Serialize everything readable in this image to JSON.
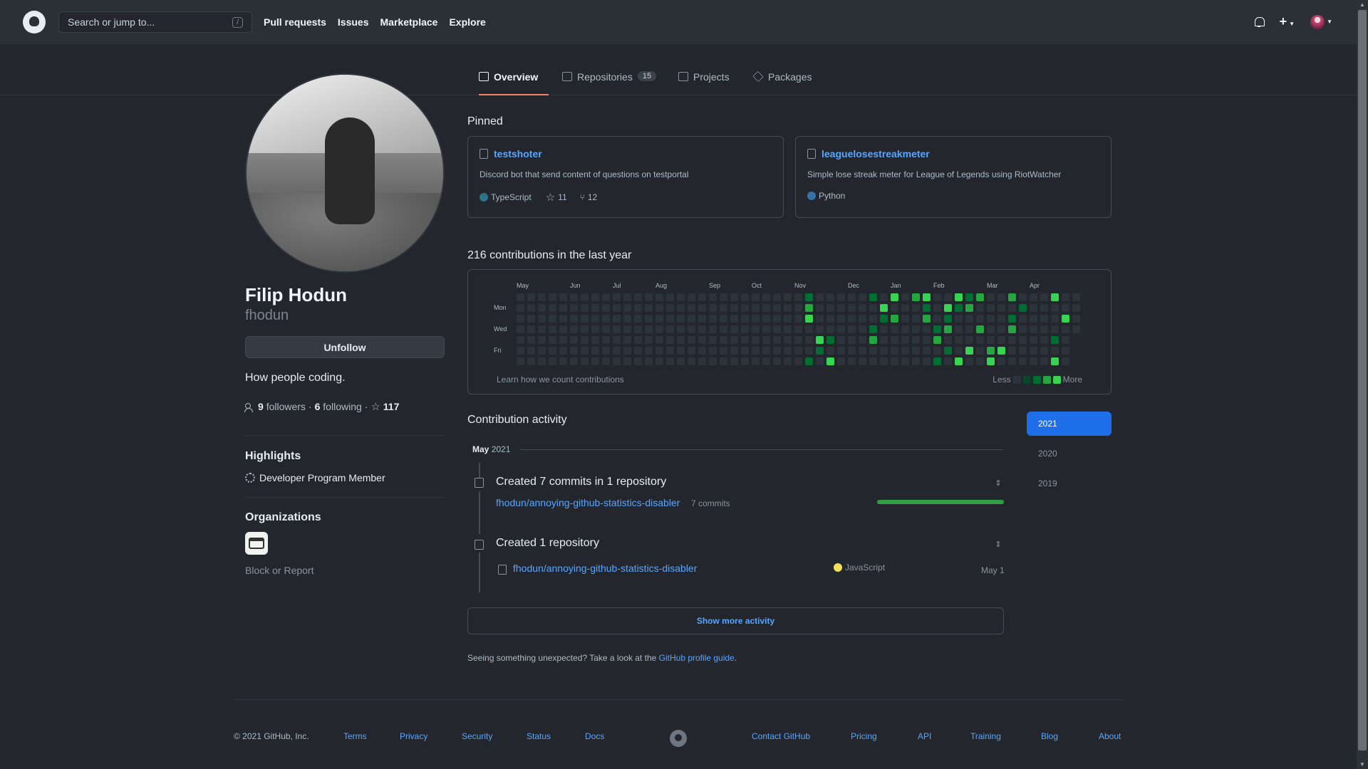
{
  "header": {
    "search_placeholder": "Search or jump to...",
    "search_key": "/",
    "nav": [
      "Pull requests",
      "Issues",
      "Marketplace",
      "Explore"
    ]
  },
  "tabs": {
    "overview": "Overview",
    "repositories": "Repositories",
    "repositories_count": "15",
    "projects": "Projects",
    "packages": "Packages"
  },
  "profile": {
    "name": "Filip Hodun",
    "login": "fhodun",
    "button": "Unfollow",
    "bio": "How people coding.",
    "followers_count": "9",
    "followers_label": "followers",
    "following_count": "6",
    "following_label": "following",
    "stars_count": "117",
    "highlights_title": "Highlights",
    "highlight": "Developer Program Member",
    "orgs_title": "Organizations",
    "block": "Block or Report"
  },
  "pinned": {
    "title": "Pinned",
    "cards": [
      {
        "name": "testshoter",
        "desc": "Discord bot that send content of questions on testportal",
        "lang": "TypeScript",
        "lang_color": "#2b7489",
        "stars": "11",
        "forks": "12"
      },
      {
        "name": "leaguelosestreakmeter",
        "desc": "Simple lose streak meter for League of Legends using RiotWatcher",
        "lang": "Python",
        "lang_color": "#3572A5"
      }
    ]
  },
  "contributions": {
    "title": "216 contributions in the last year",
    "months": [
      "May",
      "Jun",
      "Jul",
      "Aug",
      "Sep",
      "Oct",
      "Nov",
      "Dec",
      "Jan",
      "Feb",
      "Mar",
      "Apr"
    ],
    "days": [
      "Mon",
      "Wed",
      "Fri"
    ],
    "learn": "Learn how we count contributions",
    "less": "Less",
    "more": "More",
    "level_colors": [
      "#2d333b",
      "#0e4429",
      "#006d32",
      "#26a641",
      "#39d353"
    ]
  },
  "activity": {
    "title": "Contribution activity",
    "years": [
      "2021",
      "2020",
      "2019"
    ],
    "month": "May",
    "month_year": "2021",
    "items": [
      {
        "heading": "Created 7 commits in 1 repository",
        "repo": "fhodun/annoying-github-statistics-disabler",
        "meta": "7 commits"
      },
      {
        "heading": "Created 1 repository",
        "repo": "fhodun/annoying-github-statistics-disabler",
        "lang": "JavaScript",
        "lang_color": "#f1e05a",
        "date": "May 1"
      }
    ],
    "show_more": "Show more activity",
    "note_prefix": "Seeing something unexpected? Take a look at the ",
    "note_link": "GitHub profile guide",
    "note_suffix": "."
  },
  "footer": {
    "copyright": "© 2021 GitHub, Inc.",
    "links": [
      "Terms",
      "Privacy",
      "Security",
      "Status",
      "Docs",
      "Contact GitHub",
      "Pricing",
      "API",
      "Training",
      "Blog",
      "About"
    ]
  }
}
